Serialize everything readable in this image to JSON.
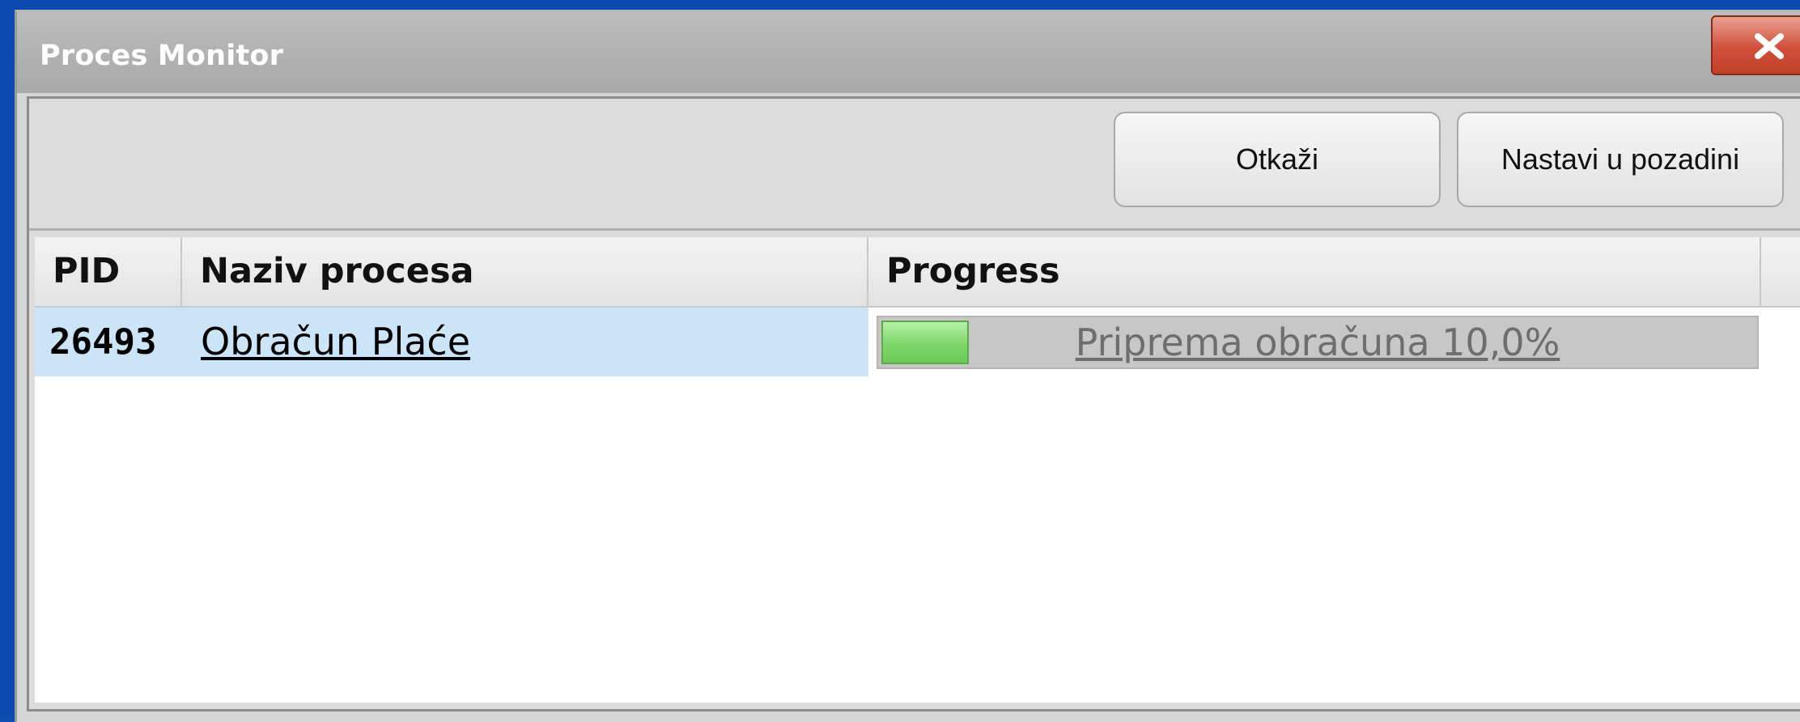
{
  "window": {
    "title": "Proces Monitor"
  },
  "toolbar": {
    "cancel_label": "Otkaži",
    "background_label": "Nastavi u pozadini"
  },
  "table": {
    "columns": [
      "PID",
      "Naziv procesa",
      "Progress"
    ],
    "rows": [
      {
        "pid": "26493",
        "name": "Obračun Plaće",
        "progress_text": "Priprema obračuna 10,0%",
        "progress_value": 0.1
      }
    ]
  },
  "colors": {
    "progress_fill": "#7dd76a",
    "selection": "#cce4f7",
    "close_button": "#d0503b"
  },
  "icons": {
    "close": "close-icon"
  }
}
